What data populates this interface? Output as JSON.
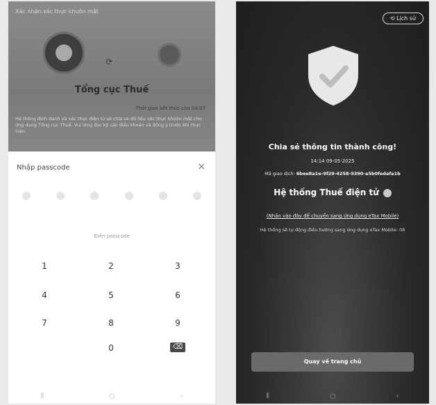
{
  "left": {
    "title": "Xác nhận xác thực khuôn mặt",
    "org_name": "Tổng cục Thuế",
    "timer": "Thời gian kết thúc còn 04:07",
    "description": "Hệ thống định danh và xác thực điện tử sẽ chia sẻ dữ liệu xác thực khuôn mặt cho ứng dụng Tổng cục Thuế. Vui lòng đọc kỹ các điều khoản và đồng ý trước khi thực hiện.",
    "sheet": {
      "title": "Nhập passcode",
      "close": "×",
      "hint": "Điền passcode",
      "keys": [
        "1",
        "2",
        "3",
        "4",
        "5",
        "6",
        "7",
        "8",
        "9",
        "0"
      ],
      "delete": "⌫"
    },
    "nav": {
      "recent": "⦀",
      "home": "○",
      "back": "‹"
    }
  },
  "right": {
    "history_label": "Lịch sử",
    "success_message": "Chia sẻ thông tin thành công!",
    "datetime": "14:14 09-05-2025",
    "transaction_label": "Mã giao dịch:",
    "transaction_id": "6bee8a1e-9f29-4258-9390-a5b0fedafa1b",
    "system_name": "Hệ thống Thuế điện tử",
    "link_text": "(Nhấn vào đây để chuyển sang ứng dụng eTax Mobile)",
    "redirect_note": "Hệ thống sẽ tự động điều hướng sang ứng dụng eTax Mobile: 08",
    "home_button": "Quay về trang chủ",
    "nav": {
      "recent": "⦀",
      "home": "○",
      "back": "‹"
    }
  },
  "colors": {
    "overlay": "#7a7a7a",
    "dark_bg": "#2a2a2a",
    "shield": "#e8e8e8",
    "check": "#bdbdbd"
  }
}
